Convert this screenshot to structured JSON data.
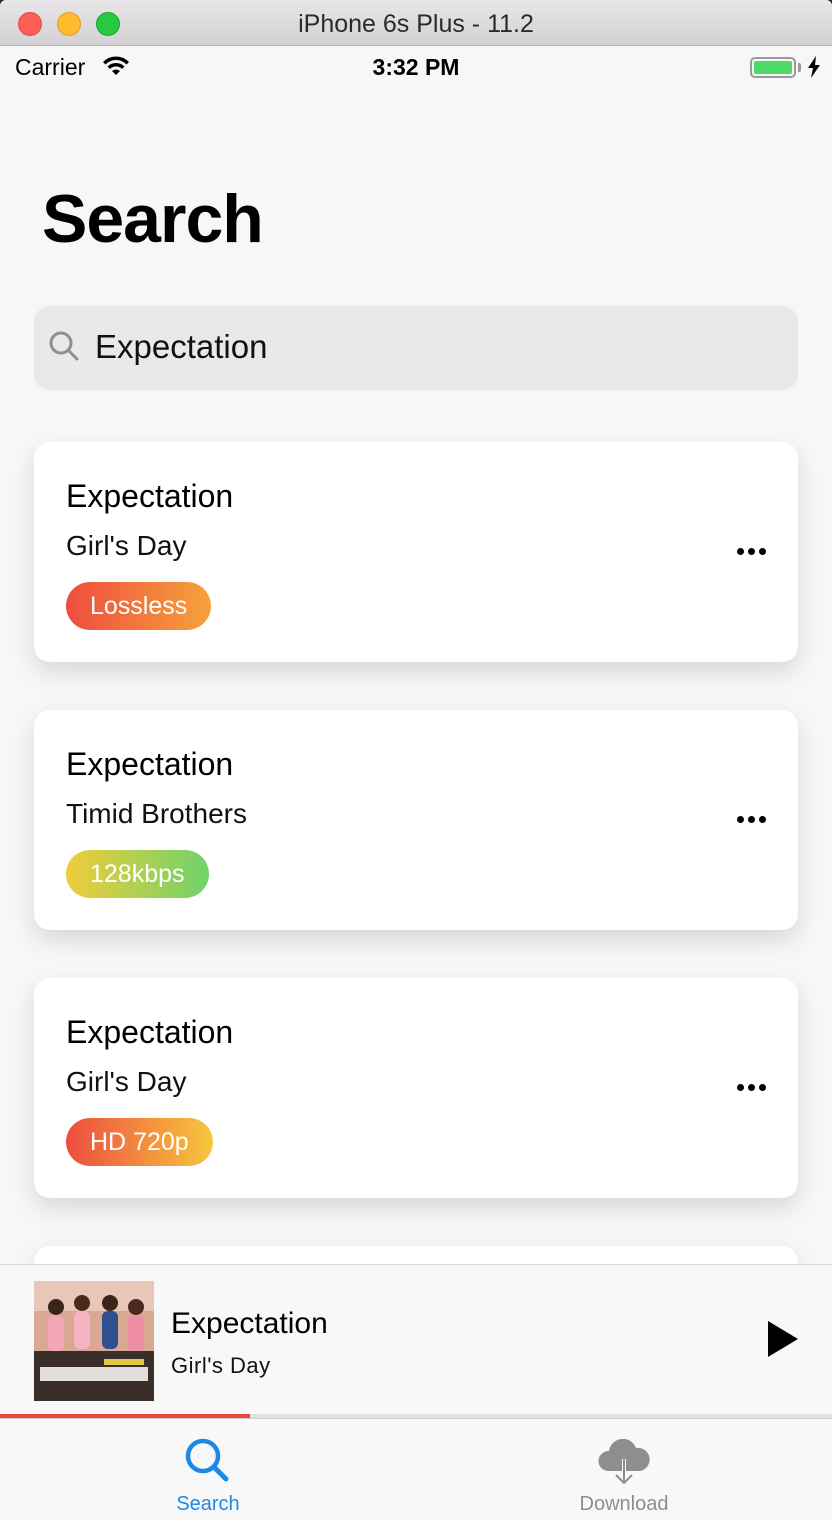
{
  "window": {
    "title": "iPhone 6s Plus - 11.2"
  },
  "status_bar": {
    "carrier": "Carrier",
    "time": "3:32 PM",
    "battery_level": 1.0
  },
  "page": {
    "title": "Search"
  },
  "search": {
    "query": "Expectation",
    "icon": "magnifier-icon"
  },
  "results": [
    {
      "title": "Expectation",
      "artist": "Girl's Day",
      "badge": "Lossless",
      "badge_colors": [
        "#ee4d3f",
        "#f6a23a"
      ]
    },
    {
      "title": "Expectation",
      "artist": "Timid Brothers",
      "badge": "128kbps",
      "badge_colors": [
        "#f1cc3a",
        "#6fd36a"
      ]
    },
    {
      "title": "Expectation",
      "artist": "Girl's Day",
      "badge": "HD 720p",
      "badge_colors": [
        "#ee4d3f",
        "#f7c63e"
      ]
    }
  ],
  "player": {
    "title": "Expectation",
    "artist": "Girl's Day",
    "progress": 0.3
  },
  "tabs": [
    {
      "label": "Search",
      "icon": "search-icon",
      "active": true
    },
    {
      "label": "Download",
      "icon": "cloud-download-icon",
      "active": false
    }
  ],
  "colors": {
    "accent": "#1e88e5",
    "progress": "#e8453c"
  }
}
